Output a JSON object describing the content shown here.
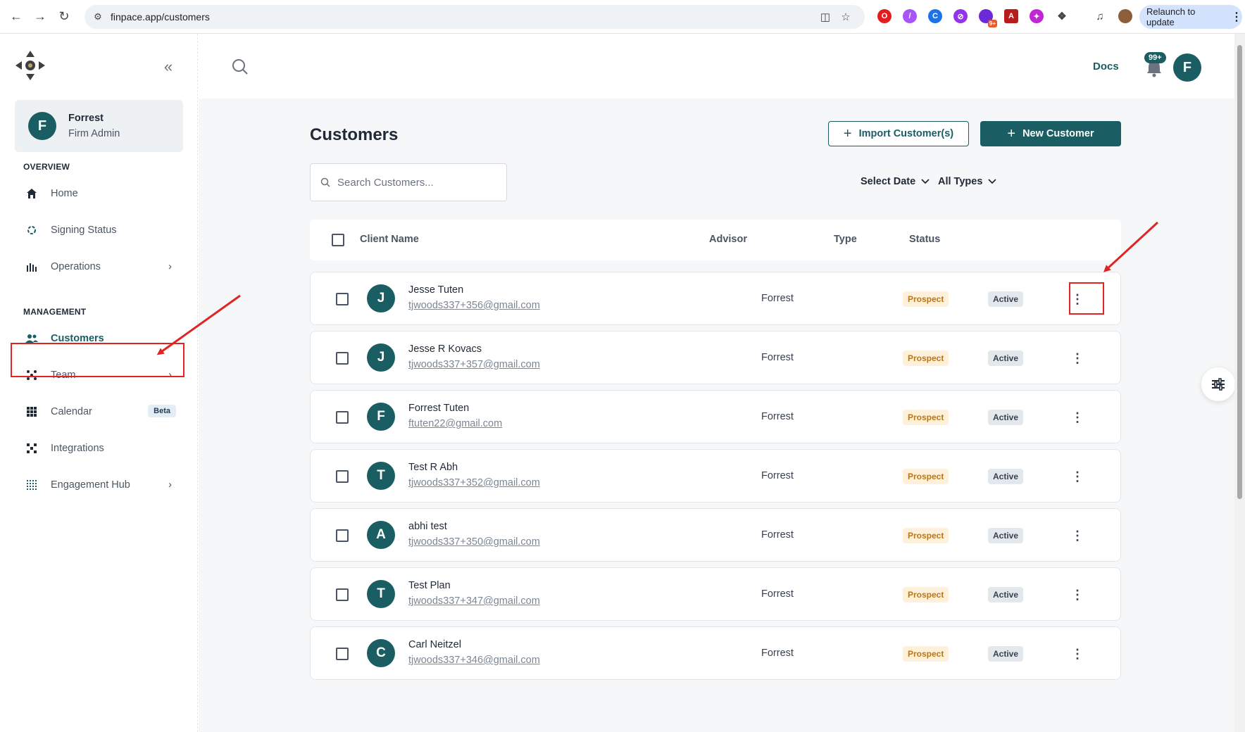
{
  "browser": {
    "url": "finpace.app/customers",
    "relaunch_label": "Relaunch to update",
    "ext_badge": "9+"
  },
  "sidebar": {
    "profile": {
      "name": "Forrest",
      "role": "Firm Admin",
      "initial": "F"
    },
    "overview_label": "OVERVIEW",
    "management_label": "MANAGEMENT",
    "overview_items": [
      {
        "label": "Home",
        "icon": "home-icon"
      },
      {
        "label": "Signing Status",
        "icon": "signing-status-icon"
      },
      {
        "label": "Operations",
        "icon": "operations-icon",
        "has_chevron": true
      }
    ],
    "management_items": [
      {
        "label": "Customers",
        "icon": "customers-icon",
        "active": true
      },
      {
        "label": "Team",
        "icon": "team-icon",
        "has_chevron": true
      },
      {
        "label": "Calendar",
        "icon": "calendar-icon",
        "badge": "Beta"
      },
      {
        "label": "Integrations",
        "icon": "integrations-icon"
      },
      {
        "label": "Engagement Hub",
        "icon": "engagement-hub-icon",
        "has_chevron": true
      }
    ]
  },
  "topbar": {
    "docs_label": "Docs",
    "notification_count": "99+",
    "user_initial": "F"
  },
  "page": {
    "title": "Customers",
    "import_label": "Import Customer(s)",
    "new_label": "New Customer",
    "search_placeholder": "Search Customers...",
    "filter_date": "Select Date",
    "filter_type": "All Types"
  },
  "table": {
    "headers": {
      "client": "Client Name",
      "advisor": "Advisor",
      "type": "Type",
      "status": "Status"
    },
    "rows": [
      {
        "initial": "J",
        "name": "Jesse Tuten",
        "email": "tjwoods337+356@gmail.com",
        "advisor": "Forrest",
        "type": "Prospect",
        "status": "Active"
      },
      {
        "initial": "J",
        "name": "Jesse R Kovacs",
        "email": "tjwoods337+357@gmail.com",
        "advisor": "Forrest",
        "type": "Prospect",
        "status": "Active"
      },
      {
        "initial": "F",
        "name": "Forrest Tuten",
        "email": "ftuten22@gmail.com",
        "advisor": "Forrest",
        "type": "Prospect",
        "status": "Active"
      },
      {
        "initial": "T",
        "name": "Test R Abh",
        "email": "tjwoods337+352@gmail.com",
        "advisor": "Forrest",
        "type": "Prospect",
        "status": "Active"
      },
      {
        "initial": "A",
        "name": "abhi test",
        "email": "tjwoods337+350@gmail.com",
        "advisor": "Forrest",
        "type": "Prospect",
        "status": "Active"
      },
      {
        "initial": "T",
        "name": "Test Plan",
        "email": "tjwoods337+347@gmail.com",
        "advisor": "Forrest",
        "type": "Prospect",
        "status": "Active"
      },
      {
        "initial": "C",
        "name": "Carl Neitzel",
        "email": "tjwoods337+346@gmail.com",
        "advisor": "Forrest",
        "type": "Prospect",
        "status": "Active"
      }
    ]
  },
  "colors": {
    "brand": "#1a5e63",
    "annotation": "#e02424",
    "prospect_bg": "#fdf1dc",
    "prospect_text": "#c2740b"
  }
}
